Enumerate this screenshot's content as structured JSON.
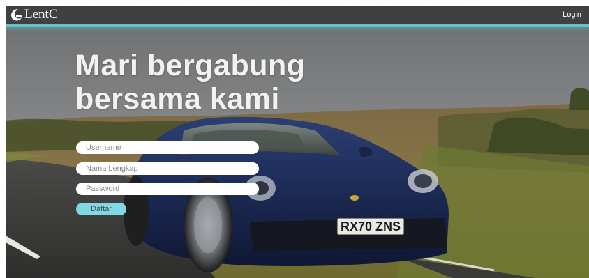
{
  "brand": {
    "name": "LentC",
    "logo_icon": "crescent-moon-icon"
  },
  "nav": {
    "login_label": "Login"
  },
  "hero": {
    "headline_line1": "Mari bergabung",
    "headline_line2": "bersama kami",
    "background_image": "sports-car-on-country-road",
    "license_plate": "RX70 ZNS"
  },
  "form": {
    "username_placeholder": "Username",
    "fullname_placeholder": "Nama Lengkap",
    "password_placeholder": "Password",
    "submit_label": "Daftar"
  },
  "colors": {
    "navbar": "#3c3c3c",
    "accent": "#5fc5c8",
    "button": "#7fd8e3",
    "headline": "#f2f2f2"
  }
}
